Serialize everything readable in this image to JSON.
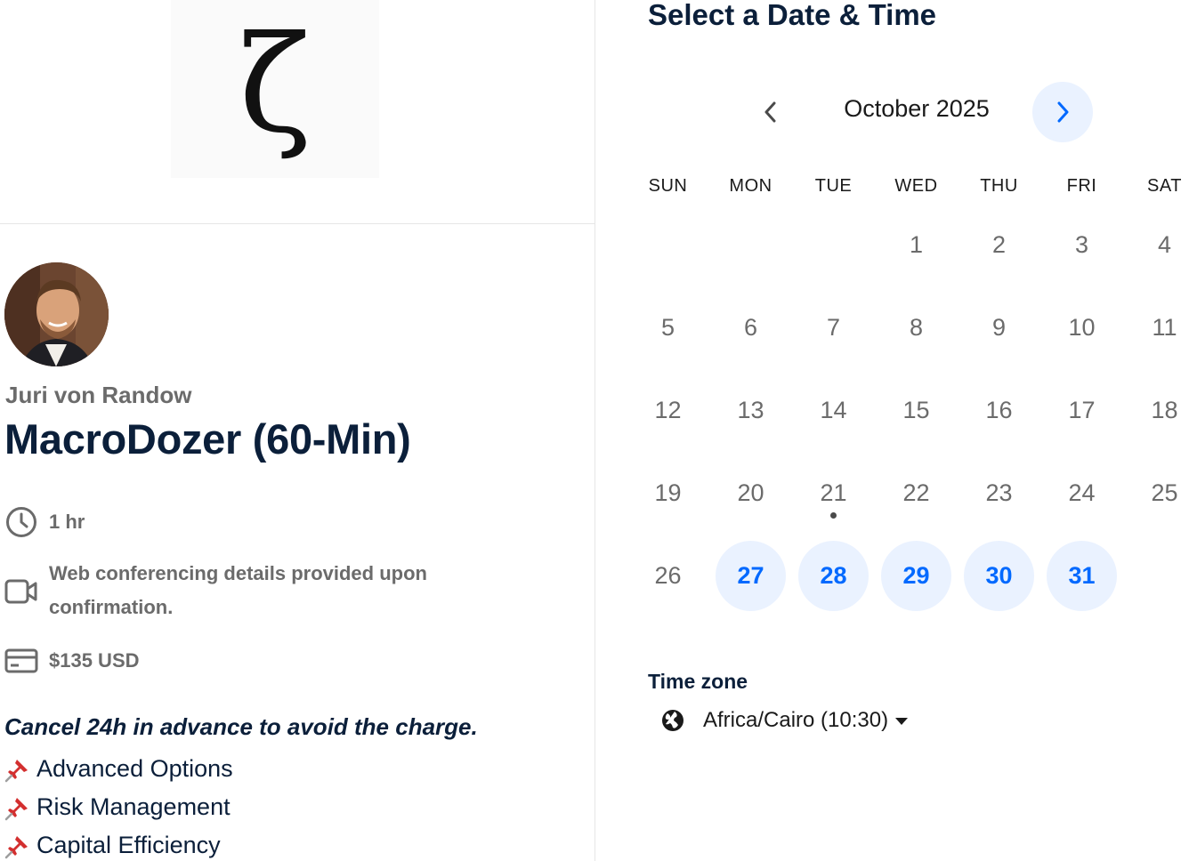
{
  "branding": {
    "logo_glyph": "ζ"
  },
  "profile": {
    "host_name": "Juri von Randow",
    "event_title": "MacroDozer (60-Min)"
  },
  "details": {
    "duration": "1 hr",
    "conferencing": "Web conferencing details provided upon confirmation.",
    "price": "$135 USD"
  },
  "description": {
    "cancel_note": "Cancel 24h in advance to avoid the charge.",
    "bullets": [
      "Advanced Options",
      "Risk Management",
      "Capital Efficiency"
    ]
  },
  "calendar": {
    "heading": "Select a Date & Time",
    "month_label": "October 2025",
    "weekdays": [
      "SUN",
      "MON",
      "TUE",
      "WED",
      "THU",
      "FRI",
      "SAT"
    ],
    "weeks": [
      [
        "",
        "",
        "",
        "1",
        "2",
        "3",
        "4"
      ],
      [
        "5",
        "6",
        "7",
        "8",
        "9",
        "10",
        "11"
      ],
      [
        "12",
        "13",
        "14",
        "15",
        "16",
        "17",
        "18"
      ],
      [
        "19",
        "20",
        "21",
        "22",
        "23",
        "24",
        "25"
      ],
      [
        "26",
        "27",
        "28",
        "29",
        "30",
        "31",
        ""
      ]
    ],
    "available_days": [
      "27",
      "28",
      "29",
      "30",
      "31"
    ],
    "today": "21"
  },
  "timezone": {
    "label": "Time zone",
    "value": "Africa/Cairo (10:30)"
  },
  "colors": {
    "accent": "#0069ff",
    "available_bg": "#eaf2ff",
    "heading": "#0b1f3a",
    "muted": "#6b6b6b"
  },
  "icons": {
    "duration": "clock-icon",
    "conferencing": "video-camera-icon",
    "price": "credit-card-icon",
    "bullet": "pushpin-icon",
    "timezone": "globe-icon"
  }
}
